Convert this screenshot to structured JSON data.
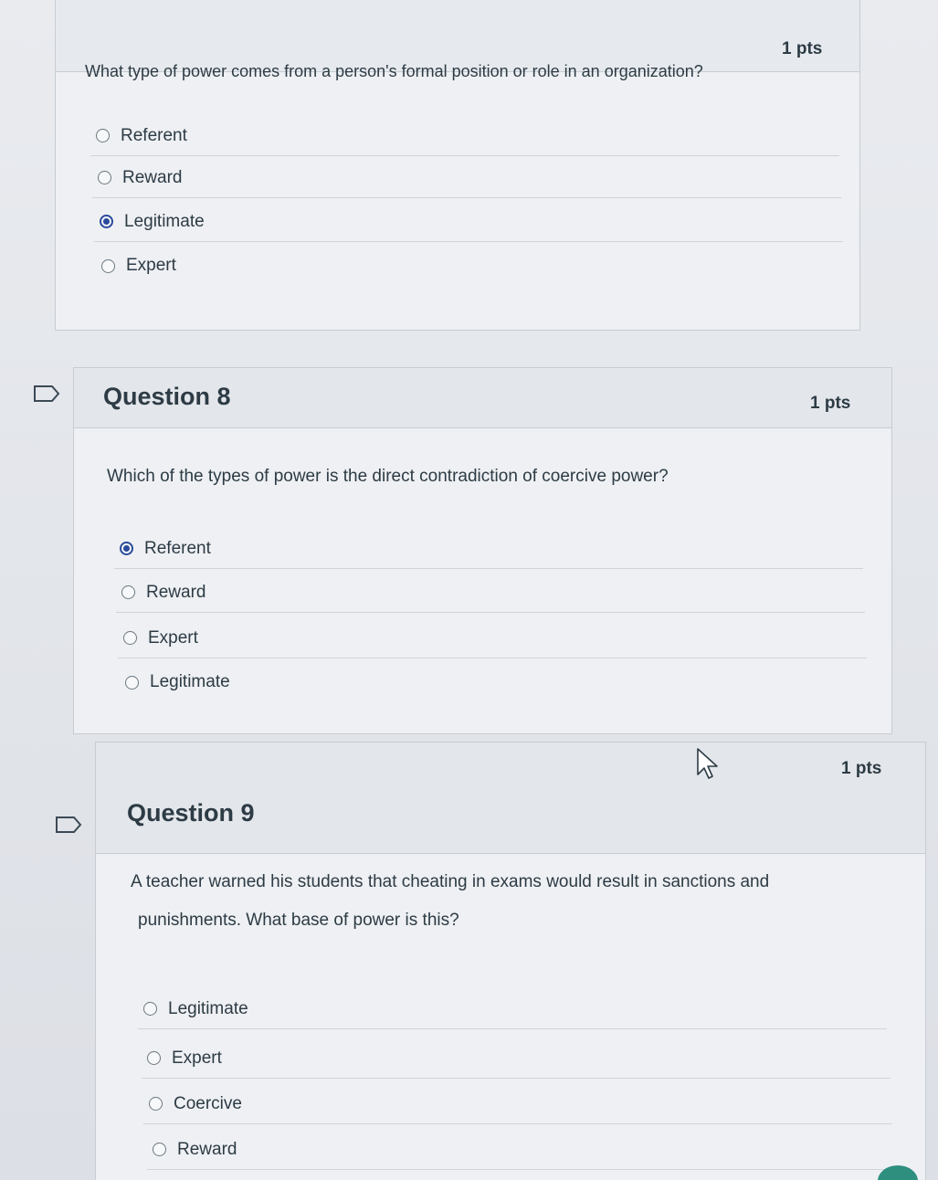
{
  "question7": {
    "points": "1 pts",
    "prompt": "What type of power comes from a person's formal position or role in an organization?",
    "answers": [
      {
        "label": "Referent",
        "selected": false
      },
      {
        "label": "Reward",
        "selected": false
      },
      {
        "label": "Legitimate",
        "selected": true
      },
      {
        "label": "Expert",
        "selected": false
      }
    ]
  },
  "question8": {
    "title": "Question 8",
    "points": "1 pts",
    "prompt": "Which of the types of power is the direct contradiction of coercive power?",
    "answers": [
      {
        "label": "Referent",
        "selected": true
      },
      {
        "label": "Reward",
        "selected": false
      },
      {
        "label": "Expert",
        "selected": false
      },
      {
        "label": "Legitimate",
        "selected": false
      }
    ]
  },
  "question9": {
    "title": "Question 9",
    "points": "1 pts",
    "prompt_line1": "A teacher warned his students that cheating in exams would result in sanctions and",
    "prompt_line2": "punishments. What base of power is this?",
    "answers": [
      {
        "label": "Legitimate",
        "selected": false
      },
      {
        "label": "Expert",
        "selected": false
      },
      {
        "label": "Coercive",
        "selected": false
      },
      {
        "label": "Reward",
        "selected": false
      }
    ]
  },
  "icons": {
    "flag": "flag-outline-icon",
    "cursor": "mouse-pointer-icon"
  },
  "colors": {
    "selected_radio": "#2a4b9b",
    "text": "#2d3b45",
    "border": "#c7cdd3"
  }
}
